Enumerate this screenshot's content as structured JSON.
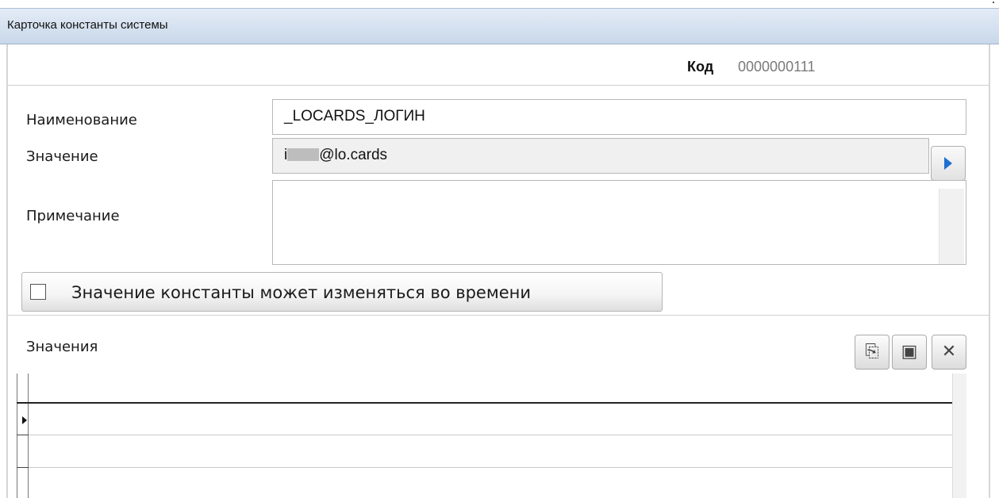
{
  "window": {
    "title": "Карточка константы системы"
  },
  "header": {
    "code_label": "Код",
    "code_value": "0000000111"
  },
  "form": {
    "name_label": "Наименование",
    "name_value": "_LOCARDS_ЛОГИН",
    "value_label": "Значение",
    "value_prefix": "i",
    "value_suffix": "@lo.cards",
    "note_label": "Примечание",
    "note_value": ""
  },
  "checkbox": {
    "label": "Значение константы может изменяться во времени",
    "checked": false
  },
  "values_section": {
    "title": "Значения",
    "toolbar": [
      {
        "name": "add-record-icon",
        "glyph": "⎘"
      },
      {
        "name": "edit-record-icon",
        "glyph": "▣"
      },
      {
        "name": "delete-record-icon",
        "glyph": "✕"
      }
    ]
  },
  "colors": {
    "title_bar_top": "#e4ecf6",
    "title_bar_bottom": "#c8d8ea",
    "accent_arrow": "#1f6fd0",
    "code_value": "#7a7a7a"
  }
}
